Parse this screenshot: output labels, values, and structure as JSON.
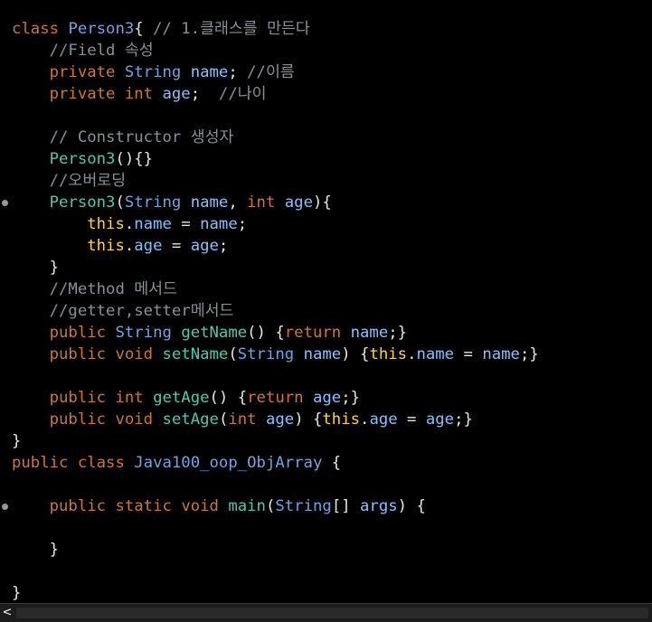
{
  "editor": {
    "colors": {
      "background": "#000000",
      "keyword": "#cc7832",
      "plain": "#e6e6e6",
      "type": "#6fa4e6",
      "variable": "#87c1ff",
      "function": "#4ec9b0",
      "comment": "#8b8f98",
      "this": "#ffd24a"
    },
    "scroll_left_label": "<",
    "fold_markers": [
      8,
      22
    ]
  },
  "lines": [
    [
      [
        "keyword",
        "class "
      ],
      [
        "type",
        "Person3"
      ],
      [
        "plain",
        "{ "
      ],
      [
        "comment",
        "// 1.클래스를 만든다"
      ]
    ],
    [
      [
        "plain",
        "    "
      ],
      [
        "comment",
        "//Field 속성"
      ]
    ],
    [
      [
        "plain",
        "    "
      ],
      [
        "keyword",
        "private "
      ],
      [
        "type",
        "String "
      ],
      [
        "var",
        "name"
      ],
      [
        "plain",
        "; "
      ],
      [
        "comment",
        "//이름"
      ]
    ],
    [
      [
        "plain",
        "    "
      ],
      [
        "keyword",
        "private "
      ],
      [
        "keyword",
        "int "
      ],
      [
        "var",
        "age"
      ],
      [
        "plain",
        ";  "
      ],
      [
        "comment",
        "//나이"
      ]
    ],
    [],
    [
      [
        "plain",
        "    "
      ],
      [
        "comment",
        "// Constructor 생성자"
      ]
    ],
    [
      [
        "plain",
        "    "
      ],
      [
        "fn",
        "Person3"
      ],
      [
        "plain",
        "(){}"
      ]
    ],
    [
      [
        "plain",
        "    "
      ],
      [
        "comment",
        "//오버로딩"
      ]
    ],
    [
      [
        "plain",
        "    "
      ],
      [
        "fn",
        "Person3"
      ],
      [
        "plain",
        "("
      ],
      [
        "type",
        "String "
      ],
      [
        "var",
        "name"
      ],
      [
        "plain",
        ", "
      ],
      [
        "keyword",
        "int "
      ],
      [
        "var",
        "age"
      ],
      [
        "plain",
        "){"
      ]
    ],
    [
      [
        "plain",
        "        "
      ],
      [
        "hl",
        "this"
      ],
      [
        "plain",
        "."
      ],
      [
        "var",
        "name"
      ],
      [
        "plain",
        " = "
      ],
      [
        "var",
        "name"
      ],
      [
        "plain",
        ";"
      ]
    ],
    [
      [
        "plain",
        "        "
      ],
      [
        "hl",
        "this"
      ],
      [
        "plain",
        "."
      ],
      [
        "var",
        "age"
      ],
      [
        "plain",
        " = "
      ],
      [
        "var",
        "age"
      ],
      [
        "plain",
        ";"
      ]
    ],
    [
      [
        "plain",
        "    }"
      ]
    ],
    [
      [
        "plain",
        "    "
      ],
      [
        "comment",
        "//Method 메서드"
      ]
    ],
    [
      [
        "plain",
        "    "
      ],
      [
        "comment",
        "//getter,setter메서드"
      ]
    ],
    [
      [
        "plain",
        "    "
      ],
      [
        "keyword",
        "public "
      ],
      [
        "type",
        "String "
      ],
      [
        "fn",
        "getName"
      ],
      [
        "plain",
        "() {"
      ],
      [
        "keyword",
        "return "
      ],
      [
        "var",
        "name"
      ],
      [
        "plain",
        ";}"
      ]
    ],
    [
      [
        "plain",
        "    "
      ],
      [
        "keyword",
        "public "
      ],
      [
        "keyword",
        "void "
      ],
      [
        "fn",
        "setName"
      ],
      [
        "plain",
        "("
      ],
      [
        "type",
        "String "
      ],
      [
        "var",
        "name"
      ],
      [
        "plain",
        ") {"
      ],
      [
        "hl",
        "this"
      ],
      [
        "plain",
        "."
      ],
      [
        "var",
        "name"
      ],
      [
        "plain",
        " = "
      ],
      [
        "var",
        "name"
      ],
      [
        "plain",
        ";}"
      ]
    ],
    [],
    [
      [
        "plain",
        "    "
      ],
      [
        "keyword",
        "public "
      ],
      [
        "keyword",
        "int "
      ],
      [
        "fn",
        "getAge"
      ],
      [
        "plain",
        "() {"
      ],
      [
        "keyword",
        "return "
      ],
      [
        "var",
        "age"
      ],
      [
        "plain",
        ";}"
      ]
    ],
    [
      [
        "plain",
        "    "
      ],
      [
        "keyword",
        "public "
      ],
      [
        "keyword",
        "void "
      ],
      [
        "fn",
        "setAge"
      ],
      [
        "plain",
        "("
      ],
      [
        "keyword",
        "int "
      ],
      [
        "var",
        "age"
      ],
      [
        "plain",
        ") {"
      ],
      [
        "hl",
        "this"
      ],
      [
        "plain",
        "."
      ],
      [
        "var",
        "age"
      ],
      [
        "plain",
        " = "
      ],
      [
        "var",
        "age"
      ],
      [
        "plain",
        ";}"
      ]
    ],
    [
      [
        "plain",
        "}"
      ]
    ],
    [
      [
        "keyword",
        "public "
      ],
      [
        "keyword",
        "class "
      ],
      [
        "type",
        "Java100_oop_ObjArray "
      ],
      [
        "plain",
        "{"
      ]
    ],
    [],
    [
      [
        "plain",
        "    "
      ],
      [
        "keyword",
        "public "
      ],
      [
        "keyword",
        "static "
      ],
      [
        "keyword",
        "void "
      ],
      [
        "fn",
        "main"
      ],
      [
        "plain",
        "("
      ],
      [
        "type",
        "String"
      ],
      [
        "plain",
        "[] "
      ],
      [
        "var",
        "args"
      ],
      [
        "plain",
        ") {"
      ]
    ],
    [],
    [
      [
        "plain",
        "    }"
      ]
    ],
    [],
    [
      [
        "plain",
        "}"
      ]
    ]
  ]
}
